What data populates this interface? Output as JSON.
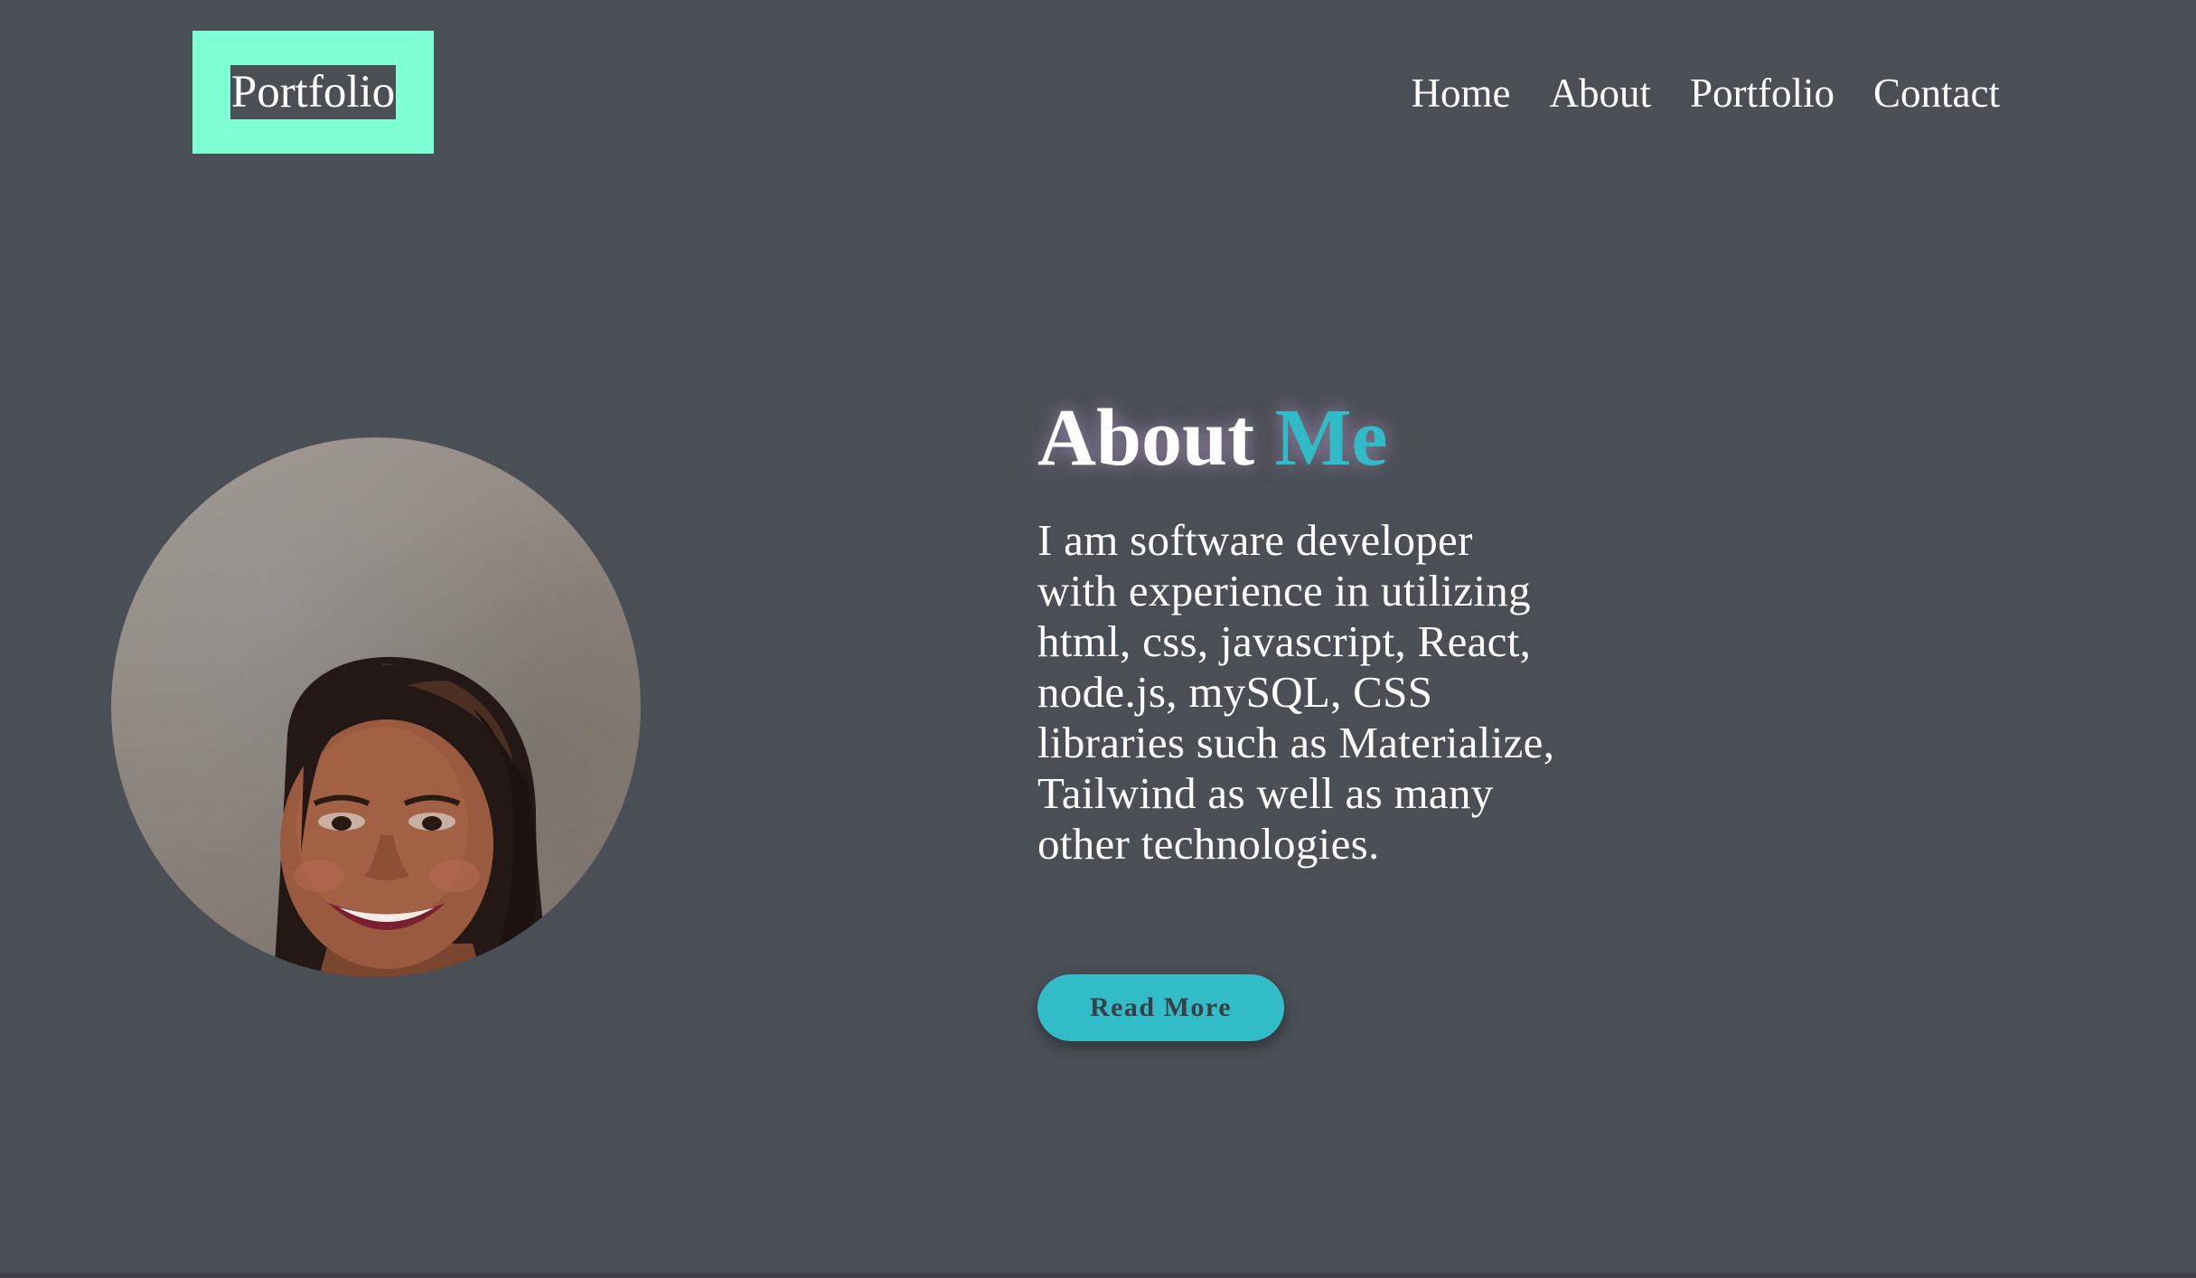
{
  "header": {
    "logo": "Portfolio",
    "nav": [
      {
        "label": "Home"
      },
      {
        "label": "About"
      },
      {
        "label": "Portfolio"
      },
      {
        "label": "Contact"
      }
    ]
  },
  "about": {
    "title_main": "About",
    "title_accent": "Me",
    "description": "I am software developer with experience in utilizing html, css, javascript, React, node.js, mySQL, CSS libraries such as Materialize, Tailwind as well as many other technologies.",
    "button_label": "Read More"
  },
  "colors": {
    "background": "#4a4e55",
    "logo_box": "#7fffd4",
    "accent": "#2fbcc8",
    "button": "#32bcc8"
  }
}
